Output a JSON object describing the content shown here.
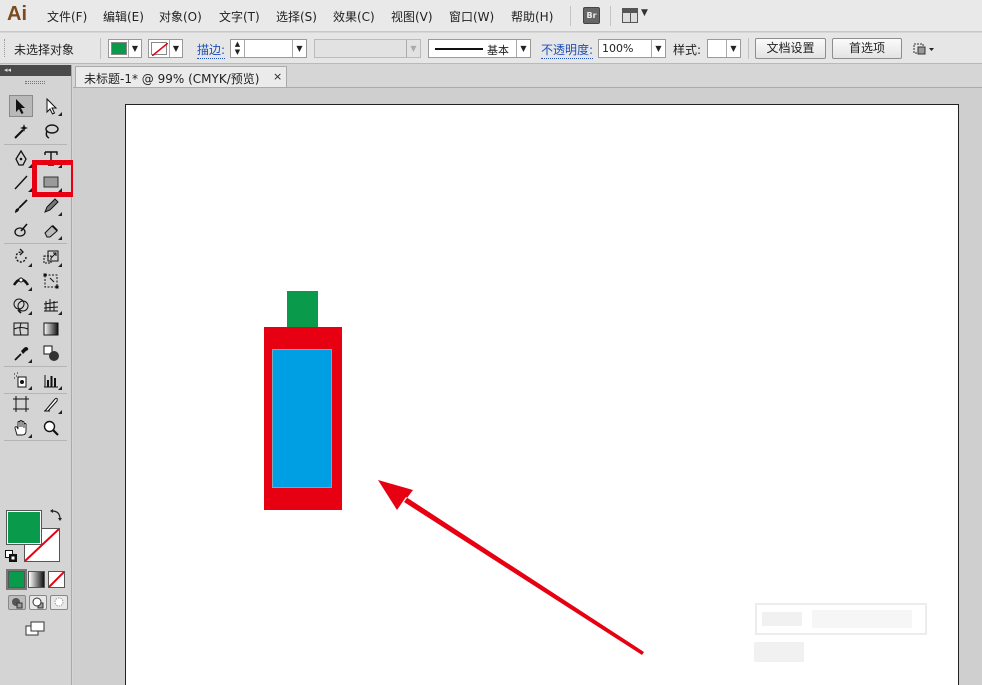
{
  "app": {
    "logo": "Ai"
  },
  "menu": {
    "items": [
      "文件(F)",
      "编辑(E)",
      "对象(O)",
      "文字(T)",
      "选择(S)",
      "效果(C)",
      "视图(V)",
      "窗口(W)",
      "帮助(H)"
    ],
    "bridge_label": "Br"
  },
  "control_bar": {
    "selection_status": "未选择对象",
    "stroke_label": "描边:",
    "stroke_style_label": "基本",
    "opacity_label": "不透明度:",
    "opacity_value": "100%",
    "style_label": "样式:",
    "document_setup_button": "文档设置",
    "preferences_button": "首选项",
    "fill_color": "#0a9a4c"
  },
  "tools": {
    "panel_collapse": "◂◂",
    "active": "selection-tool",
    "highlighted": "rectangle-tool",
    "fill_color": "#0a9a4c",
    "stroke_color": "none"
  },
  "document": {
    "tab_title": "未标题-1* @ 99% (CMYK/预览)",
    "tab_close": "×"
  },
  "artwork": {
    "cap_color": "#0a9a4c",
    "body_color": "#e60012",
    "label_color": "#009fe3",
    "arrow_color": "#e60012"
  }
}
